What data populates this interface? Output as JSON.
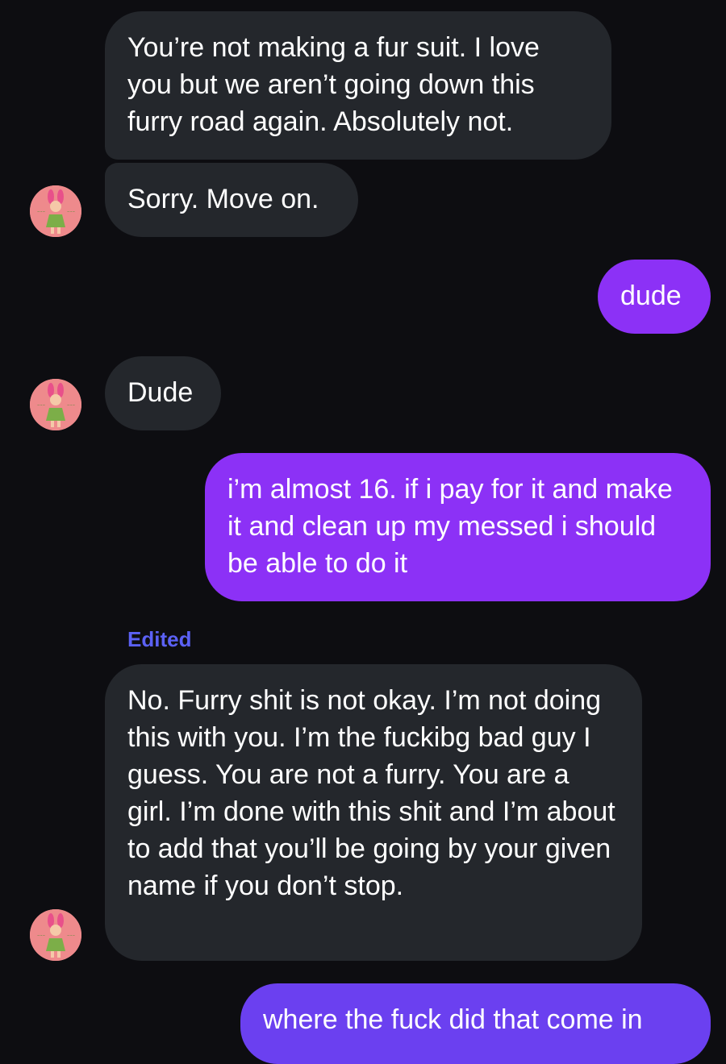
{
  "colors": {
    "background": "#0d0d11",
    "incoming_bubble": "#24272c",
    "outgoing_bubble": "#8c31f6",
    "outgoing_bubble_last": "#6b40f0",
    "edited_label": "#5b61f5",
    "avatar_bg": "#ee8a8c"
  },
  "avatar_icon": "cartoon-girl-pink-bunny-ears-icon",
  "messages": [
    {
      "direction": "incoming",
      "text": "You’re not making a fur suit. I love you but we aren’t going down this furry road again. Absolutely not."
    },
    {
      "direction": "incoming",
      "text": "Sorry. Move on."
    },
    {
      "direction": "outgoing",
      "text": "dude"
    },
    {
      "direction": "incoming",
      "text": "Dude"
    },
    {
      "direction": "outgoing",
      "text": "i’m almost 16. if i pay for it and make it and clean up my messed i should be able to do it"
    },
    {
      "direction": "incoming",
      "edited_label": "Edited",
      "text": "No. Furry shit is not okay. I’m not doing this with you. I’m the fuckibg bad guy I guess. You are not a furry. You are a girl. I’m done with this shit and I’m about to add that you’ll be going by your given name if you don’t stop."
    },
    {
      "direction": "outgoing",
      "text": "where the fuck did that come in"
    }
  ]
}
